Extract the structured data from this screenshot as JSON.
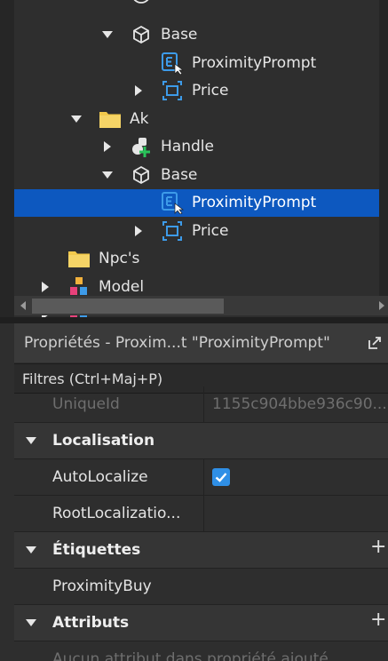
{
  "explorer": {
    "rows": [
      {
        "label": "",
        "icon": "partial-icon",
        "indent": 3,
        "arrow": "none"
      },
      {
        "label": "Base",
        "icon": "model-cube-icon",
        "indent": 3,
        "arrow": "down"
      },
      {
        "label": "ProximityPrompt",
        "icon": "proximity-prompt-icon",
        "indent": 4,
        "arrow": "none"
      },
      {
        "label": "Price",
        "icon": "billboard-gui-icon",
        "indent": 4,
        "arrow": "right"
      },
      {
        "label": "Ak",
        "icon": "folder-icon",
        "indent": 2,
        "arrow": "down"
      },
      {
        "label": "Handle",
        "icon": "handle-part-icon",
        "indent": 3,
        "arrow": "right"
      },
      {
        "label": "Base",
        "icon": "model-cube-icon",
        "indent": 3,
        "arrow": "down"
      },
      {
        "label": "ProximityPrompt",
        "icon": "proximity-prompt-icon",
        "indent": 4,
        "arrow": "none",
        "selected": true
      },
      {
        "label": "Price",
        "icon": "billboard-gui-icon",
        "indent": 4,
        "arrow": "right"
      },
      {
        "label": "Npc's",
        "icon": "folder-icon",
        "indent": 1,
        "arrow": "none"
      },
      {
        "label": "Model",
        "icon": "model-colored-icon",
        "indent": 1,
        "arrow": "right"
      },
      {
        "label": "",
        "icon": "model-colored-icon",
        "indent": 1,
        "arrow": "right"
      }
    ]
  },
  "properties": {
    "title": "Propriétés - Proxim...t \"ProximityPrompt\"",
    "filter_placeholder": "Filtres (Ctrl+Maj+P)",
    "rows": [
      {
        "type": "prop",
        "name": "UniqueId",
        "value": "1155c904bbe936c90...",
        "dim": true
      },
      {
        "type": "header",
        "name": "Localisation"
      },
      {
        "type": "prop",
        "name": "AutoLocalize",
        "value": "",
        "checkbox": true,
        "checked": true
      },
      {
        "type": "prop",
        "name": "RootLocalizatio...",
        "value": ""
      },
      {
        "type": "header",
        "name": "Étiquettes",
        "plus": true
      },
      {
        "type": "single",
        "name": "ProximityBuy"
      },
      {
        "type": "header",
        "name": "Attributs",
        "plus": true
      },
      {
        "type": "single",
        "name": "Aucun attribut dans propriété ajouté",
        "dim": true
      }
    ]
  },
  "colors": {
    "selection": "#0d58bf",
    "folder": "#f2c94c",
    "accent_blue": "#3d9be9"
  }
}
